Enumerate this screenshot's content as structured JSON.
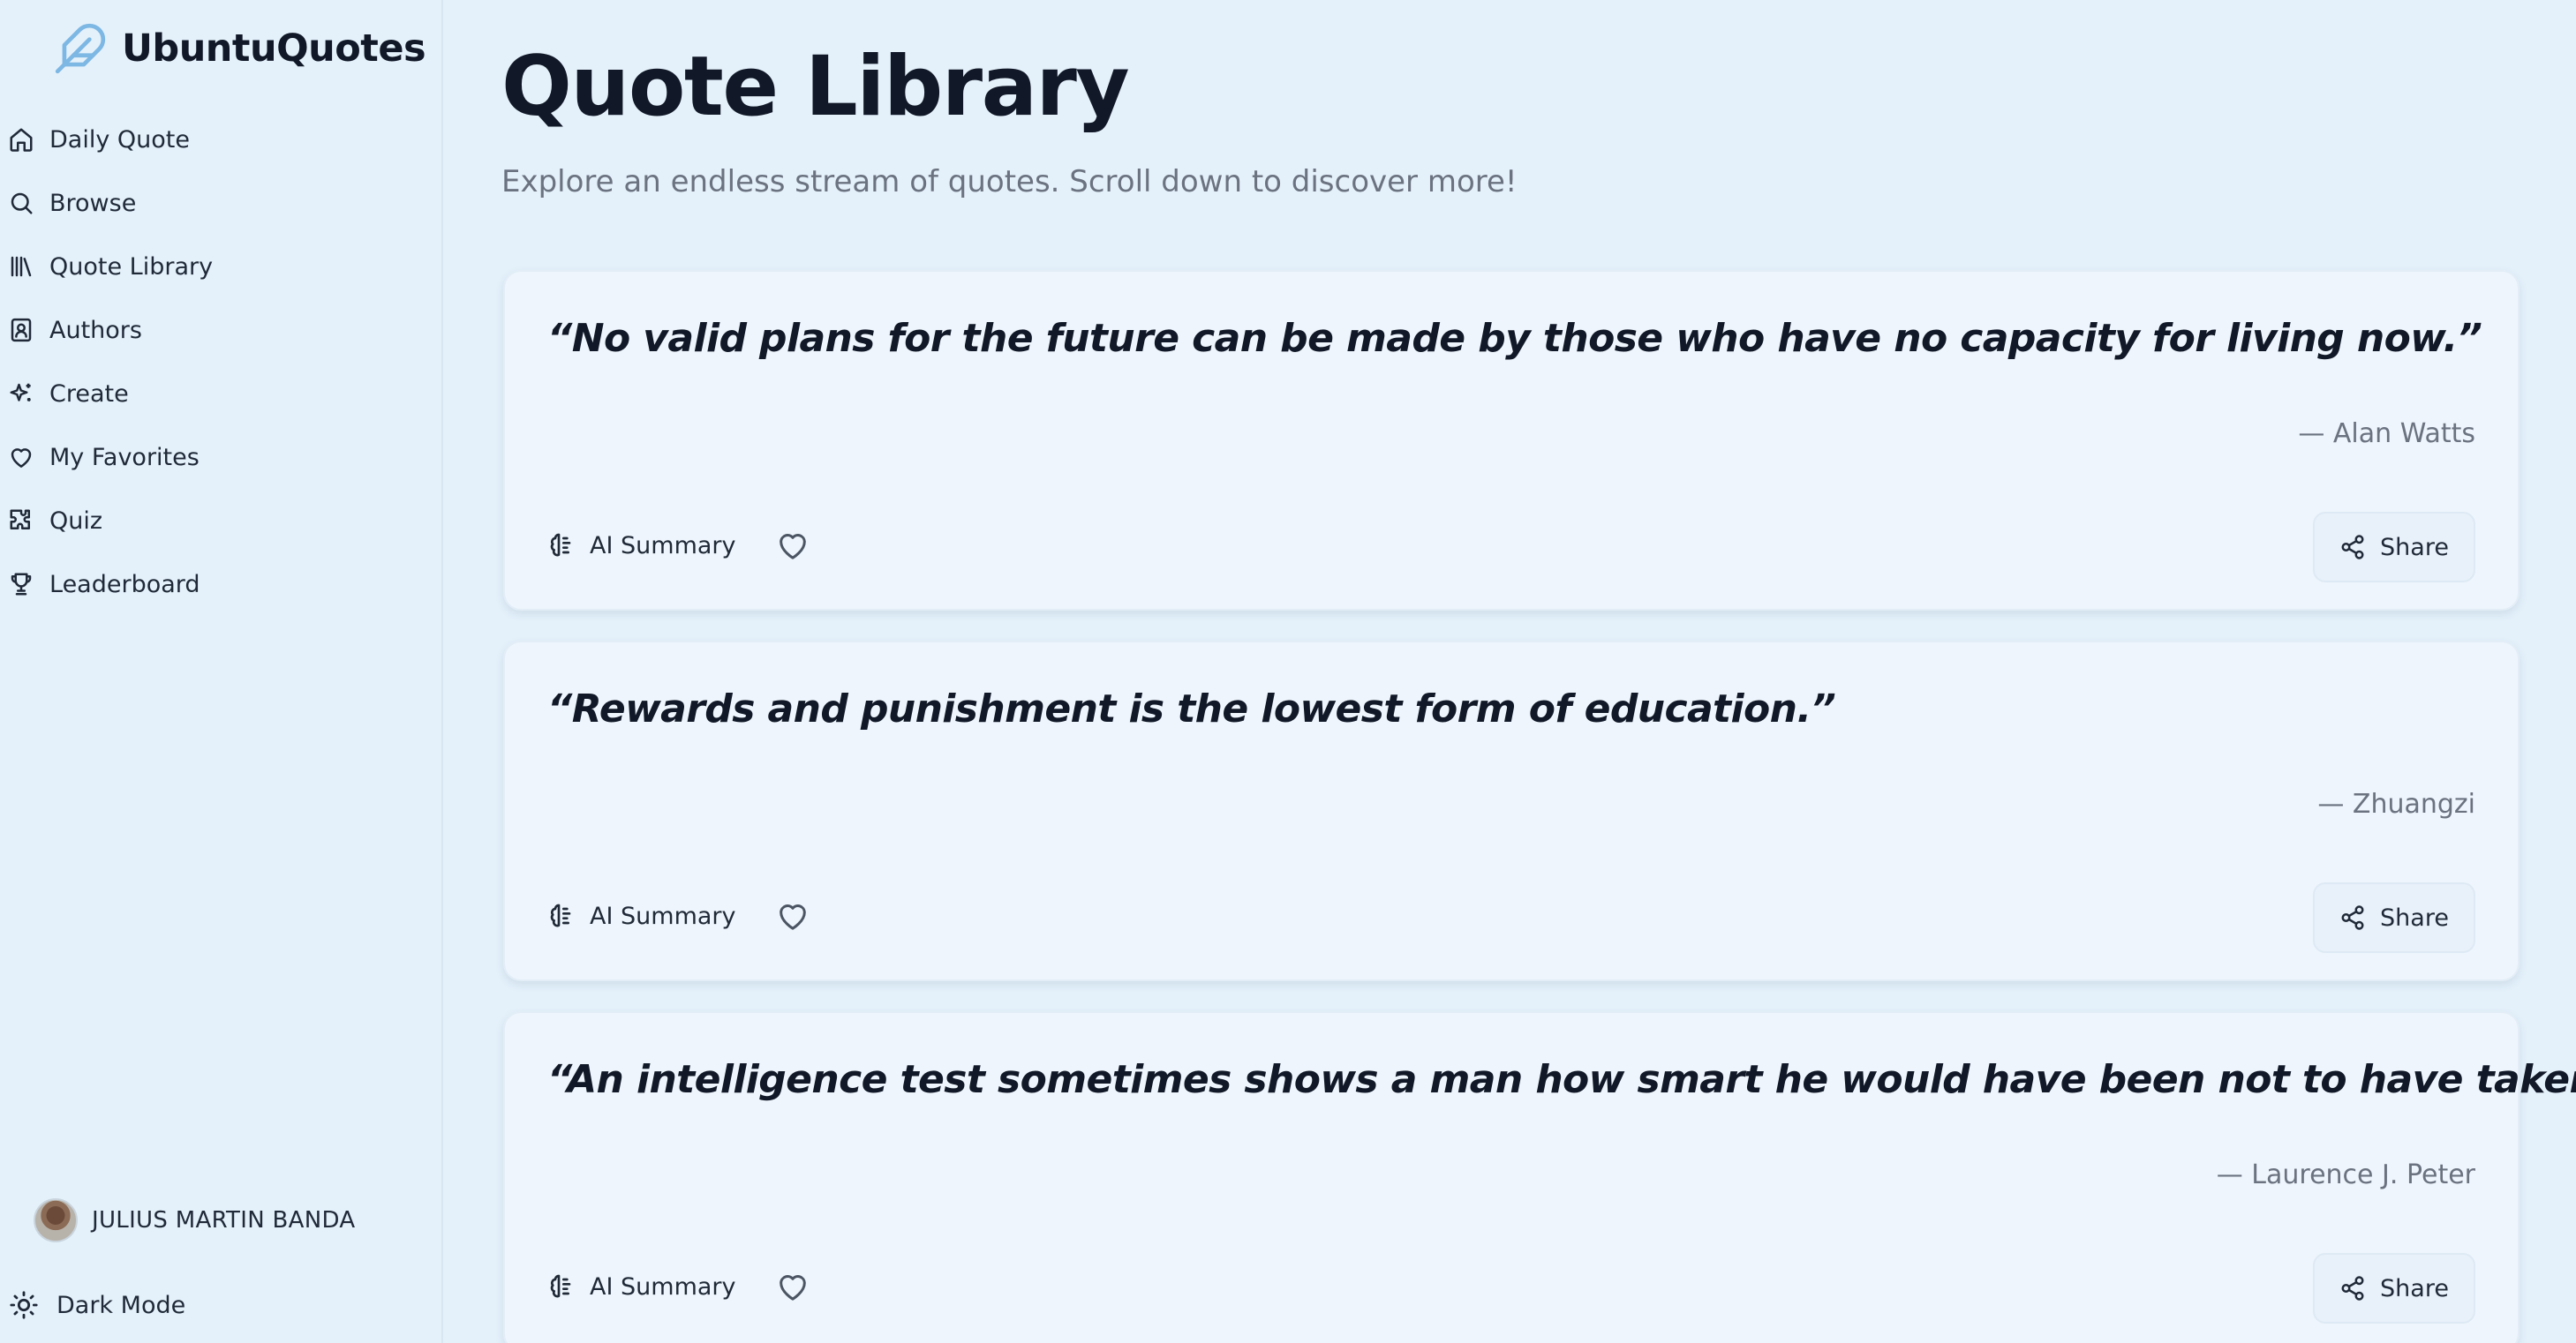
{
  "brand": {
    "name": "UbuntuQuotes",
    "logo_icon": "feather-icon",
    "accent": "#7db7e3"
  },
  "sidebar": {
    "items": [
      {
        "label": "Daily Quote",
        "icon": "home-icon"
      },
      {
        "label": "Browse",
        "icon": "search-icon"
      },
      {
        "label": "Quote Library",
        "icon": "library-icon"
      },
      {
        "label": "Authors",
        "icon": "contact-book-icon"
      },
      {
        "label": "Create",
        "icon": "sparkles-icon"
      },
      {
        "label": "My Favorites",
        "icon": "heart-icon"
      },
      {
        "label": "Quiz",
        "icon": "puzzle-icon"
      },
      {
        "label": "Leaderboard",
        "icon": "trophy-icon"
      }
    ],
    "user": {
      "name": "JULIUS MARTIN BANDA"
    },
    "dark_mode_label": "Dark Mode"
  },
  "main": {
    "title": "Quote Library",
    "subtitle": "Explore an endless stream of quotes. Scroll down to discover more!",
    "quotes": [
      {
        "text": "“No valid plans for the future can be made by those who have no capacity for living now.”",
        "author": "— Alan Watts",
        "ai_label": "AI Summary",
        "share_label": "Share"
      },
      {
        "text": "“Rewards and punishment is the lowest form of education.”",
        "author": "— Zhuangzi",
        "ai_label": "AI Summary",
        "share_label": "Share"
      },
      {
        "text": "“An intelligence test sometimes shows a man how smart he would have been not to have taken it.”",
        "author": "— Laurence J. Peter",
        "ai_label": "AI Summary",
        "share_label": "Share"
      }
    ]
  }
}
